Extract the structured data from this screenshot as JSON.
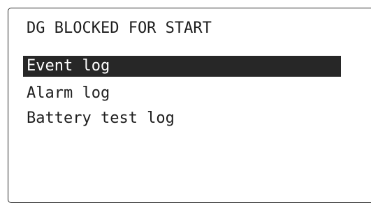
{
  "status": {
    "title": "DG BLOCKED FOR START"
  },
  "menu": {
    "items": [
      {
        "label": "Event log",
        "selected": true
      },
      {
        "label": "Alarm log",
        "selected": false
      },
      {
        "label": "Battery test log",
        "selected": false
      }
    ]
  },
  "colors": {
    "selection_background": "#272727",
    "selection_text": "#ffffff",
    "text": "#1e1e1e",
    "frame_border": "#2a2a2a"
  }
}
